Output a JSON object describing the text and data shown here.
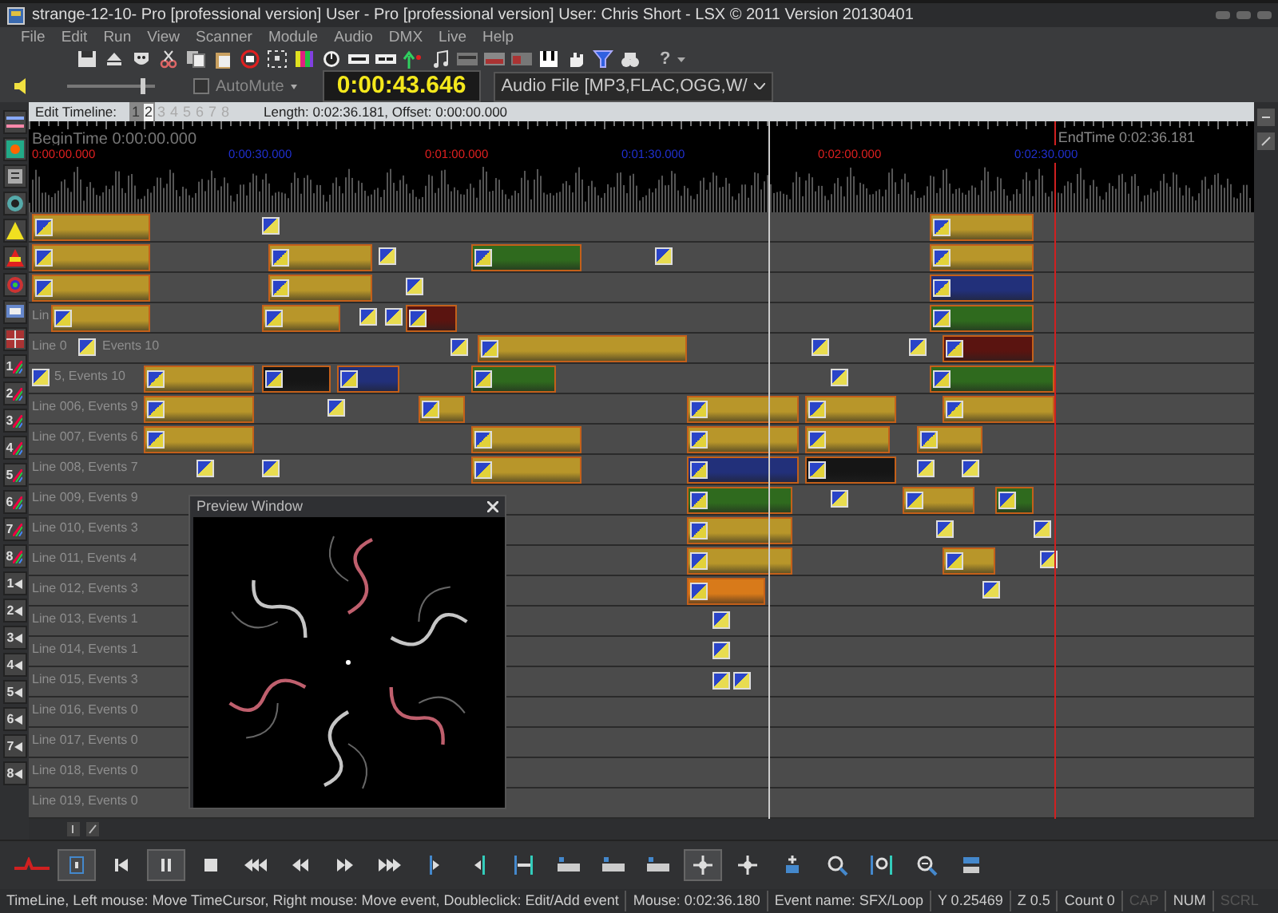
{
  "window": {
    "title": "strange-12-10- Pro [professional version] User - Pro [professional version] User: Chris Short - LSX © 2011  Version 20130401"
  },
  "menu": [
    "File",
    "Edit",
    "Run",
    "View",
    "Scanner",
    "Module",
    "Audio",
    "DMX",
    "Live",
    "Help"
  ],
  "toolbar": {
    "help_label": "?"
  },
  "transport": {
    "volume": {
      "level": 0.88
    },
    "automute": {
      "label": "AutoMute",
      "checked": false
    },
    "time": "0:00:43.646",
    "audio_source": "Audio File [MP3,FLAC,OGG,W/"
  },
  "timeline": {
    "label": "Edit Timeline:",
    "pages": [
      {
        "label": "1",
        "selected": false,
        "enabled": true
      },
      {
        "label": "2",
        "selected": true,
        "enabled": true
      },
      {
        "label": "3",
        "selected": false,
        "enabled": false
      },
      {
        "label": "4",
        "selected": false,
        "enabled": false
      },
      {
        "label": "5",
        "selected": false,
        "enabled": false
      },
      {
        "label": "6",
        "selected": false,
        "enabled": false
      },
      {
        "label": "7",
        "selected": false,
        "enabled": false
      },
      {
        "label": "8",
        "selected": false,
        "enabled": false
      }
    ],
    "info": "Length: 0:02:36.181, Offset: 0:00:00.000",
    "begin_time": "BeginTime 0:00:00.000",
    "end_time": "EndTime 0:02:36.181",
    "ruler_labels": [
      {
        "text": "0:00:00.000",
        "color": "#e02020"
      },
      {
        "text": "0:00:30.000",
        "color": "#2030d0"
      },
      {
        "text": "0:01:00.000",
        "color": "#e02020"
      },
      {
        "text": "0:01:30.000",
        "color": "#2030d0"
      },
      {
        "text": "0:02:00.000",
        "color": "#e02020"
      },
      {
        "text": "0:02:30.000",
        "color": "#2030d0"
      }
    ]
  },
  "lines": [
    {
      "events": [
        {
          "kind": "clip",
          "color": "#b8962a"
        },
        {
          "kind": "marker"
        },
        {
          "kind": "clip",
          "color": "#b8962a"
        }
      ]
    },
    {
      "events": [
        {
          "kind": "clip",
          "color": "#b8962a"
        },
        {
          "kind": "clip",
          "color": "#b8962a"
        },
        {
          "kind": "marker"
        },
        {
          "kind": "clip",
          "color": "#2f6a1e"
        },
        {
          "kind": "marker"
        },
        {
          "kind": "clip",
          "color": "#b8962a"
        }
      ]
    },
    {
      "events": [
        {
          "kind": "clip",
          "color": "#b8962a"
        },
        {
          "kind": "clip",
          "color": "#b8962a"
        },
        {
          "kind": "marker"
        },
        {
          "kind": "clip",
          "color": "#22307a"
        }
      ]
    },
    {
      "label": "Lin",
      "events": [
        {
          "kind": "clip",
          "color": "#b8962a"
        },
        {
          "kind": "clip",
          "color": "#b8962a"
        },
        {
          "kind": "marker"
        },
        {
          "kind": "marker"
        },
        {
          "kind": "clip",
          "color": "#5a1410"
        },
        {
          "kind": "clip",
          "color": "#2f6a1e"
        }
      ]
    },
    {
      "label": "Line 0",
      "label_tail": "Events 10",
      "events": [
        {
          "kind": "marker"
        },
        {
          "kind": "marker"
        },
        {
          "kind": "clip",
          "color": "#b8962a"
        },
        {
          "kind": "marker"
        },
        {
          "kind": "marker"
        },
        {
          "kind": "clip",
          "color": "#5a1410"
        }
      ]
    },
    {
      "label_tail": "5, Events 10",
      "events": [
        {
          "kind": "marker"
        },
        {
          "kind": "clip",
          "color": "#b8962a"
        },
        {
          "kind": "clip",
          "color": "#151515"
        },
        {
          "kind": "clip",
          "color": "#22307a"
        },
        {
          "kind": "clip",
          "color": "#2f6a1e"
        },
        {
          "kind": "marker"
        },
        {
          "kind": "clip",
          "color": "#2f6a1e"
        }
      ]
    },
    {
      "label": "Line 006, Events 9",
      "events": [
        {
          "kind": "clip",
          "color": "#b8962a"
        },
        {
          "kind": "marker"
        },
        {
          "kind": "clip",
          "color": "#b8962a"
        },
        {
          "kind": "clip",
          "color": "#b8962a"
        },
        {
          "kind": "clip",
          "color": "#b8962a"
        },
        {
          "kind": "clip",
          "color": "#b8962a"
        }
      ]
    },
    {
      "label": "Line 007, Events 6",
      "events": [
        {
          "kind": "clip",
          "color": "#b8962a"
        },
        {
          "kind": "clip",
          "color": "#b8962a"
        },
        {
          "kind": "clip",
          "color": "#b8962a"
        },
        {
          "kind": "clip",
          "color": "#b8962a"
        },
        {
          "kind": "clip",
          "color": "#b8962a"
        }
      ]
    },
    {
      "label": "Line 008, Events 7",
      "events": [
        {
          "kind": "marker"
        },
        {
          "kind": "marker"
        },
        {
          "kind": "clip",
          "color": "#b8962a"
        },
        {
          "kind": "clip",
          "color": "#22307a"
        },
        {
          "kind": "clip",
          "color": "#151515"
        },
        {
          "kind": "marker"
        },
        {
          "kind": "marker"
        }
      ]
    },
    {
      "label": "Line 009, Events 9",
      "events": [
        {
          "kind": "clip",
          "color": "#2f6a1e"
        },
        {
          "kind": "marker"
        },
        {
          "kind": "clip",
          "color": "#b8962a"
        },
        {
          "kind": "clip",
          "color": "#2f6a1e"
        }
      ]
    },
    {
      "label": "Line 010, Events 3",
      "events": [
        {
          "kind": "clip",
          "color": "#b8962a"
        },
        {
          "kind": "marker"
        },
        {
          "kind": "marker"
        }
      ]
    },
    {
      "label": "Line 011, Events 4",
      "events": [
        {
          "kind": "clip",
          "color": "#b8962a"
        },
        {
          "kind": "clip",
          "color": "#b8962a"
        },
        {
          "kind": "marker"
        }
      ]
    },
    {
      "label": "Line 012, Events 3",
      "events": [
        {
          "kind": "clip",
          "color": "#d87a1a"
        },
        {
          "kind": "marker"
        }
      ]
    },
    {
      "label": "Line 013, Events 1",
      "events": [
        {
          "kind": "marker"
        }
      ]
    },
    {
      "label": "Line 014, Events 1",
      "events": [
        {
          "kind": "marker"
        }
      ]
    },
    {
      "label": "Line 015, Events 3",
      "events": [
        {
          "kind": "marker"
        },
        {
          "kind": "marker"
        }
      ]
    },
    {
      "label": "Line 016, Events 0"
    },
    {
      "label": "Line 017, Events 0"
    },
    {
      "label": "Line 018, Events 0"
    },
    {
      "label": "Line 019, Events 0"
    }
  ],
  "layer_buttons": [
    "1",
    "2",
    "3",
    "4",
    "5",
    "6",
    "7",
    "8"
  ],
  "output_buttons": [
    "1",
    "2",
    "3",
    "4",
    "5",
    "6",
    "7",
    "8"
  ],
  "preview_window": {
    "title": "Preview Window"
  },
  "player": [
    {
      "kind": "loop",
      "selected": true
    },
    {
      "kind": "prev",
      "selected": false
    },
    {
      "kind": "pause",
      "selected": true
    },
    {
      "kind": "stop",
      "selected": false
    },
    {
      "kind": "fast_rewind",
      "selected": false
    },
    {
      "kind": "rewind",
      "selected": false
    },
    {
      "kind": "forward",
      "selected": false
    },
    {
      "kind": "fast_forward",
      "selected": false
    },
    {
      "kind": "mark_in",
      "selected": false
    },
    {
      "kind": "mark_out",
      "selected": false
    },
    {
      "kind": "range",
      "selected": false
    },
    {
      "kind": "strip",
      "selected": false
    },
    {
      "kind": "strip",
      "selected": false
    },
    {
      "kind": "strip",
      "selected": false
    },
    {
      "kind": "move",
      "selected": true
    },
    {
      "kind": "move",
      "selected": false
    },
    {
      "kind": "add",
      "selected": false
    },
    {
      "kind": "zoom_in",
      "selected": false
    },
    {
      "kind": "zoom_range",
      "selected": false
    },
    {
      "kind": "zoom_out",
      "selected": false
    },
    {
      "kind": "collapse",
      "selected": false
    }
  ],
  "status_bar": {
    "hint": "TimeLine, Left mouse: Move TimeCursor, Right mouse: Move event, Doubleclick: Edit/Add event",
    "mouse": "Mouse: 0:02:36.180",
    "event_name": "Event name: SFX/Loop",
    "y": "Y 0.25469",
    "z": "Z 0.5",
    "count": "Count 0",
    "keys": [
      {
        "label": "CAP",
        "on": false
      },
      {
        "label": "NUM",
        "on": true
      },
      {
        "label": "SCRL",
        "on": false
      }
    ]
  }
}
